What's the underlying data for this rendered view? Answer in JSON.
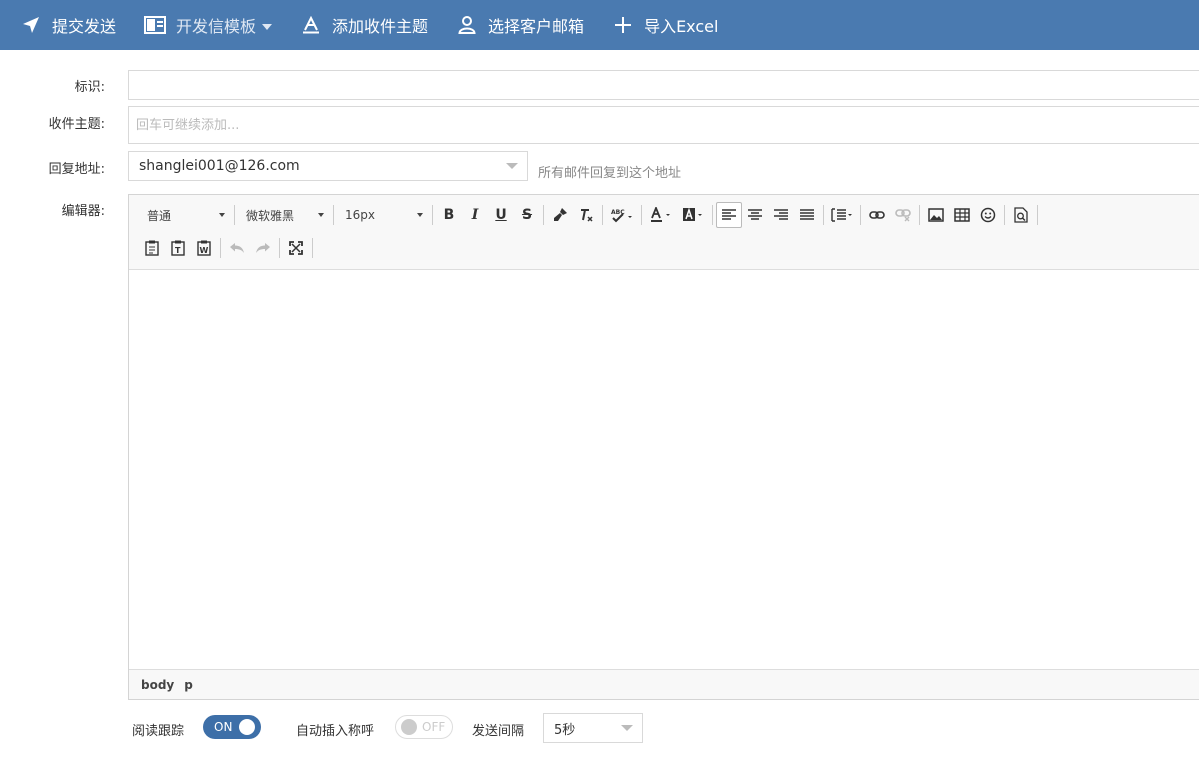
{
  "toolbar": {
    "submit_label": "提交发送",
    "template_label": "开发信模板",
    "add_subject_label": "添加收件主题",
    "choose_email_label": "选择客户邮箱",
    "import_label": "导入Excel"
  },
  "form": {
    "id_label": "标识:",
    "id_value": "",
    "subject_label": "收件主题:",
    "subject_placeholder": "回车可继续添加...",
    "reply_label": "回复地址:",
    "reply_value": "shanglei001@126.com",
    "reply_hint": "所有邮件回复到这个地址",
    "editor_label": "编辑器:"
  },
  "editor": {
    "paragraph_format": "普通",
    "font_family": "微软雅黑",
    "font_size": "16px",
    "path": [
      "body",
      "p"
    ]
  },
  "options": {
    "read_tracking_label": "阅读跟踪",
    "read_tracking_state": "ON",
    "auto_greeting_label": "自动插入称呼",
    "auto_greeting_state": "OFF",
    "interval_label": "发送间隔",
    "interval_value": "5秒"
  },
  "colors": {
    "topbar": "#4a7ab0",
    "toggle_on": "#3d6fa8"
  }
}
